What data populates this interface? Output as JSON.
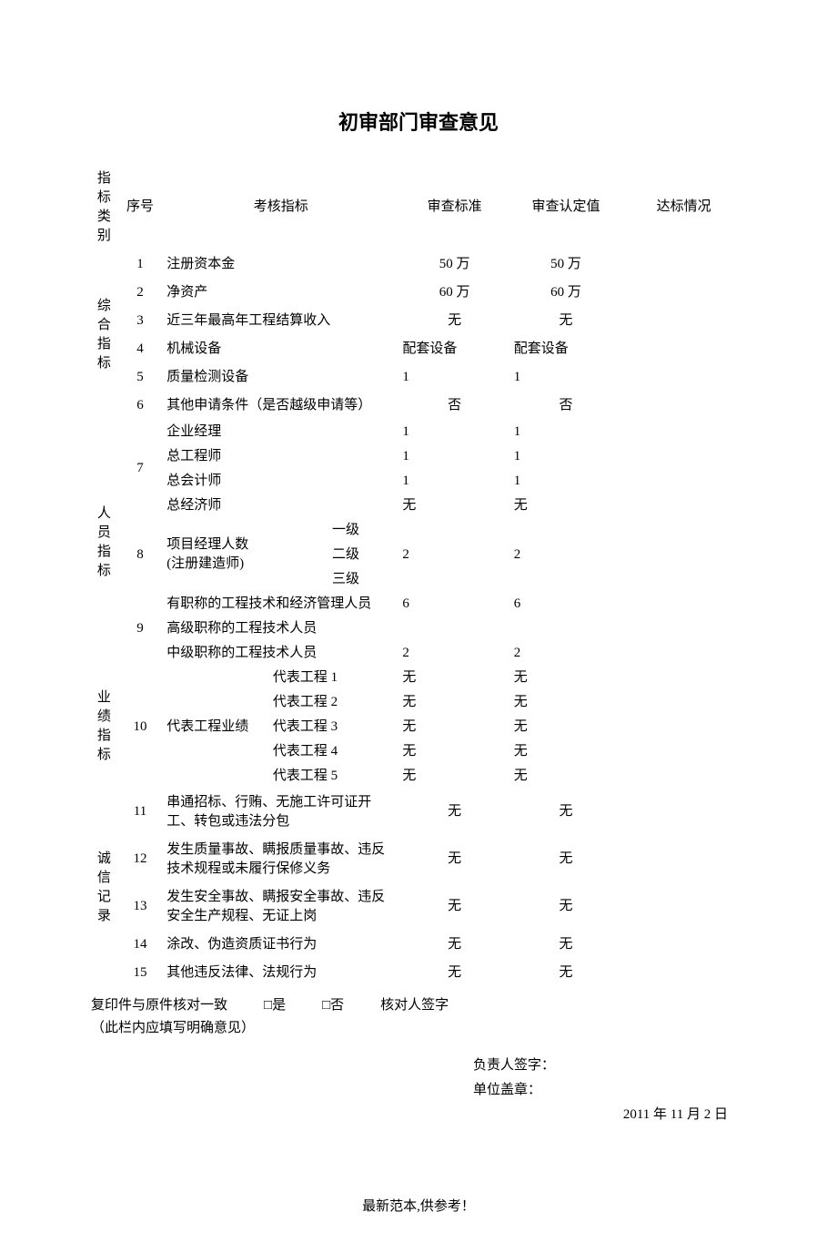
{
  "title": "初审部门审查意见",
  "headers": {
    "category": "指标类别",
    "seq": "序号",
    "indicator": "考核指标",
    "standard": "审查标准",
    "value": "审查认定值",
    "status": "达标情况"
  },
  "categories": {
    "comprehensive": "综合指标",
    "personnel": "人员指标",
    "performance": "业绩指标",
    "integrity": "诚信记录"
  },
  "rows": {
    "r1": {
      "seq": "1",
      "indicator": "注册资本金",
      "standard": "50 万",
      "value": "50 万"
    },
    "r2": {
      "seq": "2",
      "indicator": "净资产",
      "standard": "60 万",
      "value": "60 万"
    },
    "r3": {
      "seq": "3",
      "indicator": "近三年最高年工程结算收入",
      "standard": "无",
      "value": "无"
    },
    "r4": {
      "seq": "4",
      "indicator": "机械设备",
      "standard": "配套设备",
      "value": "配套设备"
    },
    "r5": {
      "seq": "5",
      "indicator": "质量检测设备",
      "standard": "1",
      "value": "1"
    },
    "r6": {
      "seq": "6",
      "indicator": "其他申请条件（是否越级申请等）",
      "standard": "否",
      "value": "否"
    },
    "r7": {
      "seq": "7",
      "sub": [
        {
          "indicator": "企业经理",
          "standard": "1",
          "value": "1"
        },
        {
          "indicator": "总工程师",
          "standard": "1",
          "value": "1"
        },
        {
          "indicator": "总会计师",
          "standard": "1",
          "value": "1"
        },
        {
          "indicator": "总经济师",
          "standard": "无",
          "value": "无"
        }
      ]
    },
    "r8": {
      "seq": "8",
      "indicator_main": "项目经理人数\n(注册建造师)",
      "levels": [
        "一级",
        "二级",
        "三级"
      ],
      "standard": "2",
      "value": "2"
    },
    "r9": {
      "seq": "9",
      "sub": [
        {
          "indicator": "有职称的工程技术和经济管理人员",
          "standard": "6",
          "value": "6"
        },
        {
          "indicator": "高级职称的工程技术人员",
          "standard": "",
          "value": ""
        },
        {
          "indicator": "中级职称的工程技术人员",
          "standard": "2",
          "value": "2"
        }
      ]
    },
    "r10": {
      "seq": "10",
      "indicator_main": "代表工程业绩",
      "projects": [
        "代表工程 1",
        "代表工程 2",
        "代表工程 3",
        "代表工程 4",
        "代表工程 5"
      ],
      "standard": [
        "无",
        "无",
        "无",
        "无",
        "无"
      ],
      "value": [
        "无",
        "无",
        "无",
        "无",
        "无"
      ]
    },
    "r11": {
      "seq": "11",
      "indicator": "串通招标、行贿、无施工许可证开工、转包或违法分包",
      "standard": "无",
      "value": "无"
    },
    "r12": {
      "seq": "12",
      "indicator": "发生质量事故、瞒报质量事故、违反技术规程或未履行保修义务",
      "standard": "无",
      "value": "无"
    },
    "r13": {
      "seq": "13",
      "indicator": "发生安全事故、瞒报安全事故、违反安全生产规程、无证上岗",
      "standard": "无",
      "value": "无"
    },
    "r14": {
      "seq": "14",
      "indicator": "涂改、伪造资质证书行为",
      "standard": "无",
      "value": "无"
    },
    "r15": {
      "seq": "15",
      "indicator": "其他违反法律、法规行为",
      "standard": "无",
      "value": "无"
    }
  },
  "footer": {
    "check_label": "复印件与原件核对一致",
    "check_yes": "□是",
    "check_no": "□否",
    "verifier_label": "核对人签字",
    "note": "（此栏内应填写明确意见）",
    "responsible": "负责人签字：",
    "stamp": "单位盖章：",
    "date": "2011 年 11  月   2  日"
  },
  "bottom_note": "最新范本,供参考！"
}
